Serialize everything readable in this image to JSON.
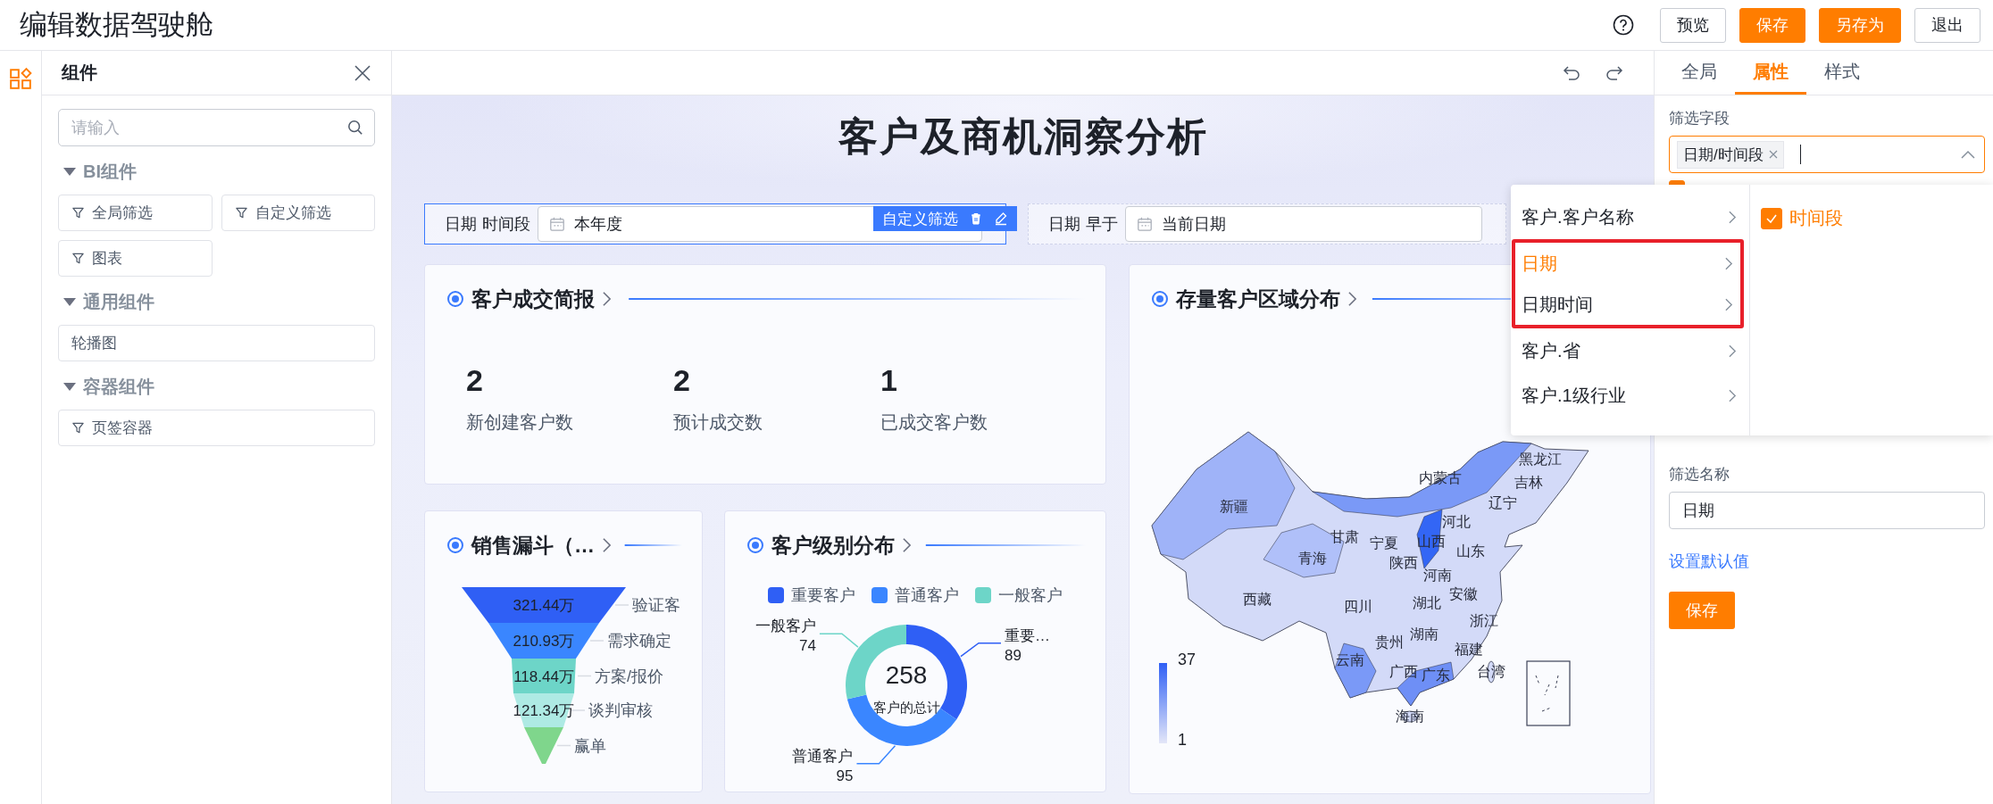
{
  "header": {
    "title": "编辑数据驾驶舱",
    "buttons": [
      {
        "label": "预览",
        "kind": "default"
      },
      {
        "label": "保存",
        "kind": "primary"
      },
      {
        "label": "另存为",
        "kind": "primary"
      },
      {
        "label": "退出",
        "kind": "default"
      }
    ]
  },
  "components_panel": {
    "title": "组件",
    "search": {
      "placeholder": "请输入"
    },
    "groups": [
      {
        "title": "BI组件",
        "expanded": true,
        "items": [
          {
            "label": "全局筛选",
            "kind": "filter",
            "full_width": false
          },
          {
            "label": "自定义筛选",
            "kind": "filter",
            "full_width": false
          },
          {
            "label": "图表",
            "kind": "filter",
            "full_width": false
          }
        ]
      },
      {
        "title": "通用组件",
        "expanded": true,
        "items": [
          {
            "label": "轮播图",
            "kind": "plain",
            "full_width": true
          }
        ]
      },
      {
        "title": "容器组件",
        "expanded": true,
        "items": [
          {
            "label": "页签容器",
            "kind": "filter",
            "full_width": true
          }
        ]
      }
    ]
  },
  "dashboard": {
    "title": "客户及商机洞察分析",
    "filters": [
      {
        "field": "日期",
        "operator": "时间段",
        "value": "本年度",
        "selected": true
      },
      {
        "field": "日期",
        "operator": "早于",
        "value": "当前日期",
        "selected": false
      }
    ],
    "filter_toolbar": {
      "label": "自定义筛选"
    },
    "summary_card": {
      "title": "客户成交简报",
      "stats": [
        {
          "value": "2",
          "label": "新创建客户数"
        },
        {
          "value": "2",
          "label": "预计成交数"
        },
        {
          "value": "1",
          "label": "已成交客户数"
        }
      ]
    },
    "funnel_card": {
      "title": "销售漏斗（…",
      "stages": [
        {
          "value": "321.44万",
          "label": "验证客",
          "color": "#2f5ff5"
        },
        {
          "value": "210.93万",
          "label": "需求确定",
          "color": "#3a86ff"
        },
        {
          "value": "118.44万",
          "label": "方案/报价",
          "color": "#6dd5c8"
        },
        {
          "value": "121.34万",
          "label": "谈判审核",
          "color": "#aeeae4"
        },
        {
          "label": "赢单",
          "color": "#7fd68c"
        }
      ]
    },
    "donut_card": {
      "title": "客户级别分布",
      "legend": [
        {
          "color": "#2f5ff5"
        },
        {
          "color": "#3a86ff"
        },
        {
          "color": "#6dd5c8"
        }
      ],
      "chart_data": {
        "type": "donut",
        "categories": [
          "重要客户",
          "普通客户",
          "一般客户"
        ],
        "values": [
          89,
          95,
          74
        ],
        "data_labels": true
      },
      "slice_labels": [
        {
          "name": "重要…",
          "value": "89"
        },
        {
          "name": "普通客户",
          "value": "95"
        },
        {
          "name": "一般客户",
          "value": "74"
        }
      ],
      "total": "258",
      "total_label": "客户的总计"
    },
    "map_card": {
      "title": "存量客户区域分布",
      "regions": [
        "黑龙江",
        "内蒙古",
        "吉林",
        "辽宁",
        "新疆",
        "河北",
        "甘肃",
        "宁夏",
        "山西",
        "山东",
        "青海",
        "陕西",
        "河南",
        "西藏",
        "四川",
        "湖北",
        "安徽",
        "浙江",
        "贵州",
        "湖南",
        "福建",
        "云南",
        "广西",
        "广东",
        "台湾",
        "海南"
      ],
      "legend": {
        "max": "37",
        "min": "1"
      }
    }
  },
  "properties_panel": {
    "tabs": [
      {
        "label": "全局",
        "selected": false
      },
      {
        "label": "属性",
        "selected": true
      },
      {
        "label": "样式",
        "selected": false
      }
    ],
    "field_label": "筛选字段",
    "field_tags": [
      "日期/时间段"
    ],
    "option_checkbox": {
      "checked": true
    },
    "name_label": "筛选名称",
    "name_value": "日期",
    "default_link": "设置默认值",
    "save_button": "保存"
  },
  "field_dropdown": {
    "fields": [
      {
        "label": "客户.客户名称",
        "selected": false,
        "highlighted": false
      },
      {
        "label": "日期",
        "selected": true,
        "highlighted": true
      },
      {
        "label": "日期时间",
        "selected": false,
        "highlighted": true
      },
      {
        "label": "客户.省",
        "selected": false,
        "highlighted": false
      },
      {
        "label": "客户.1级行业",
        "selected": false,
        "highlighted": false
      }
    ],
    "options": [
      {
        "label": "时间段",
        "checked": true
      }
    ]
  }
}
